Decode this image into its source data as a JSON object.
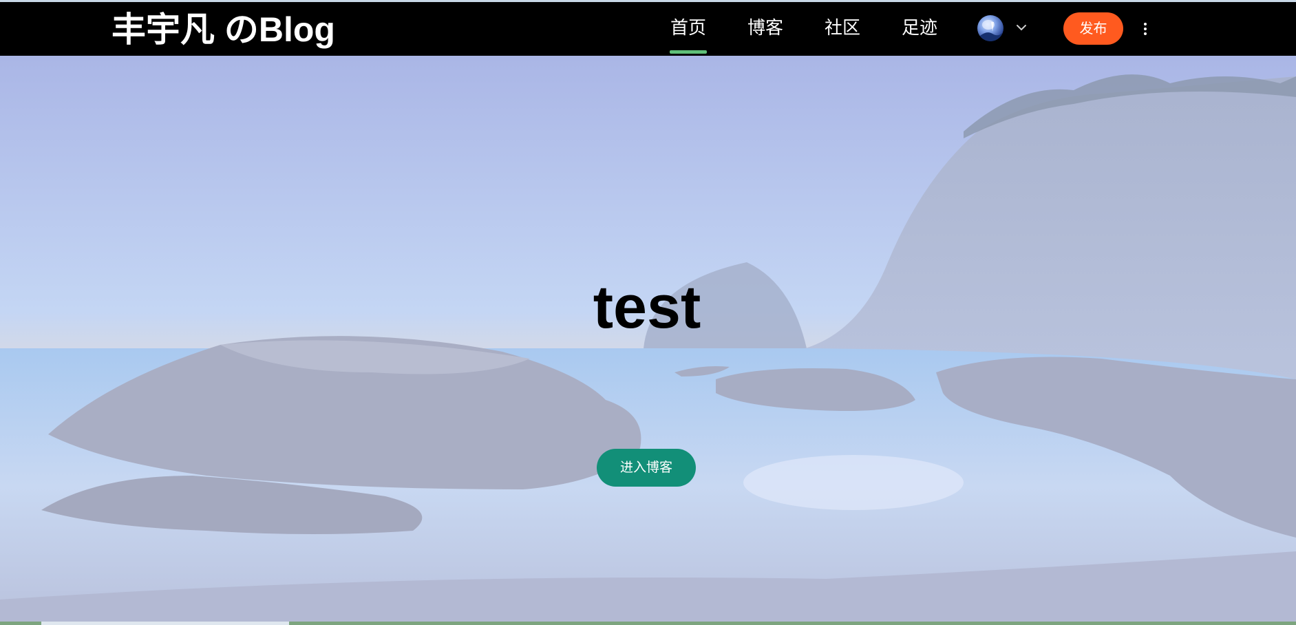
{
  "navbar": {
    "brand": "丰宇凡 のBlog",
    "items": [
      {
        "label": "首页",
        "active": true
      },
      {
        "label": "博客",
        "active": false
      },
      {
        "label": "社区",
        "active": false
      },
      {
        "label": "足迹",
        "active": false
      }
    ],
    "publish_label": "发布",
    "icons": {
      "avatar": "user-avatar",
      "dropdown": "chevron-down-icon",
      "more": "vertical-dots-icon"
    }
  },
  "hero": {
    "title": "test",
    "enter_label": "进入博客",
    "background": "coastal-sea-rocks-photo"
  },
  "colors": {
    "navbar_bg": "#000000",
    "active_underline": "#5fbf78",
    "publish_button": "#ff5a1f",
    "enter_button": "#128f78"
  }
}
